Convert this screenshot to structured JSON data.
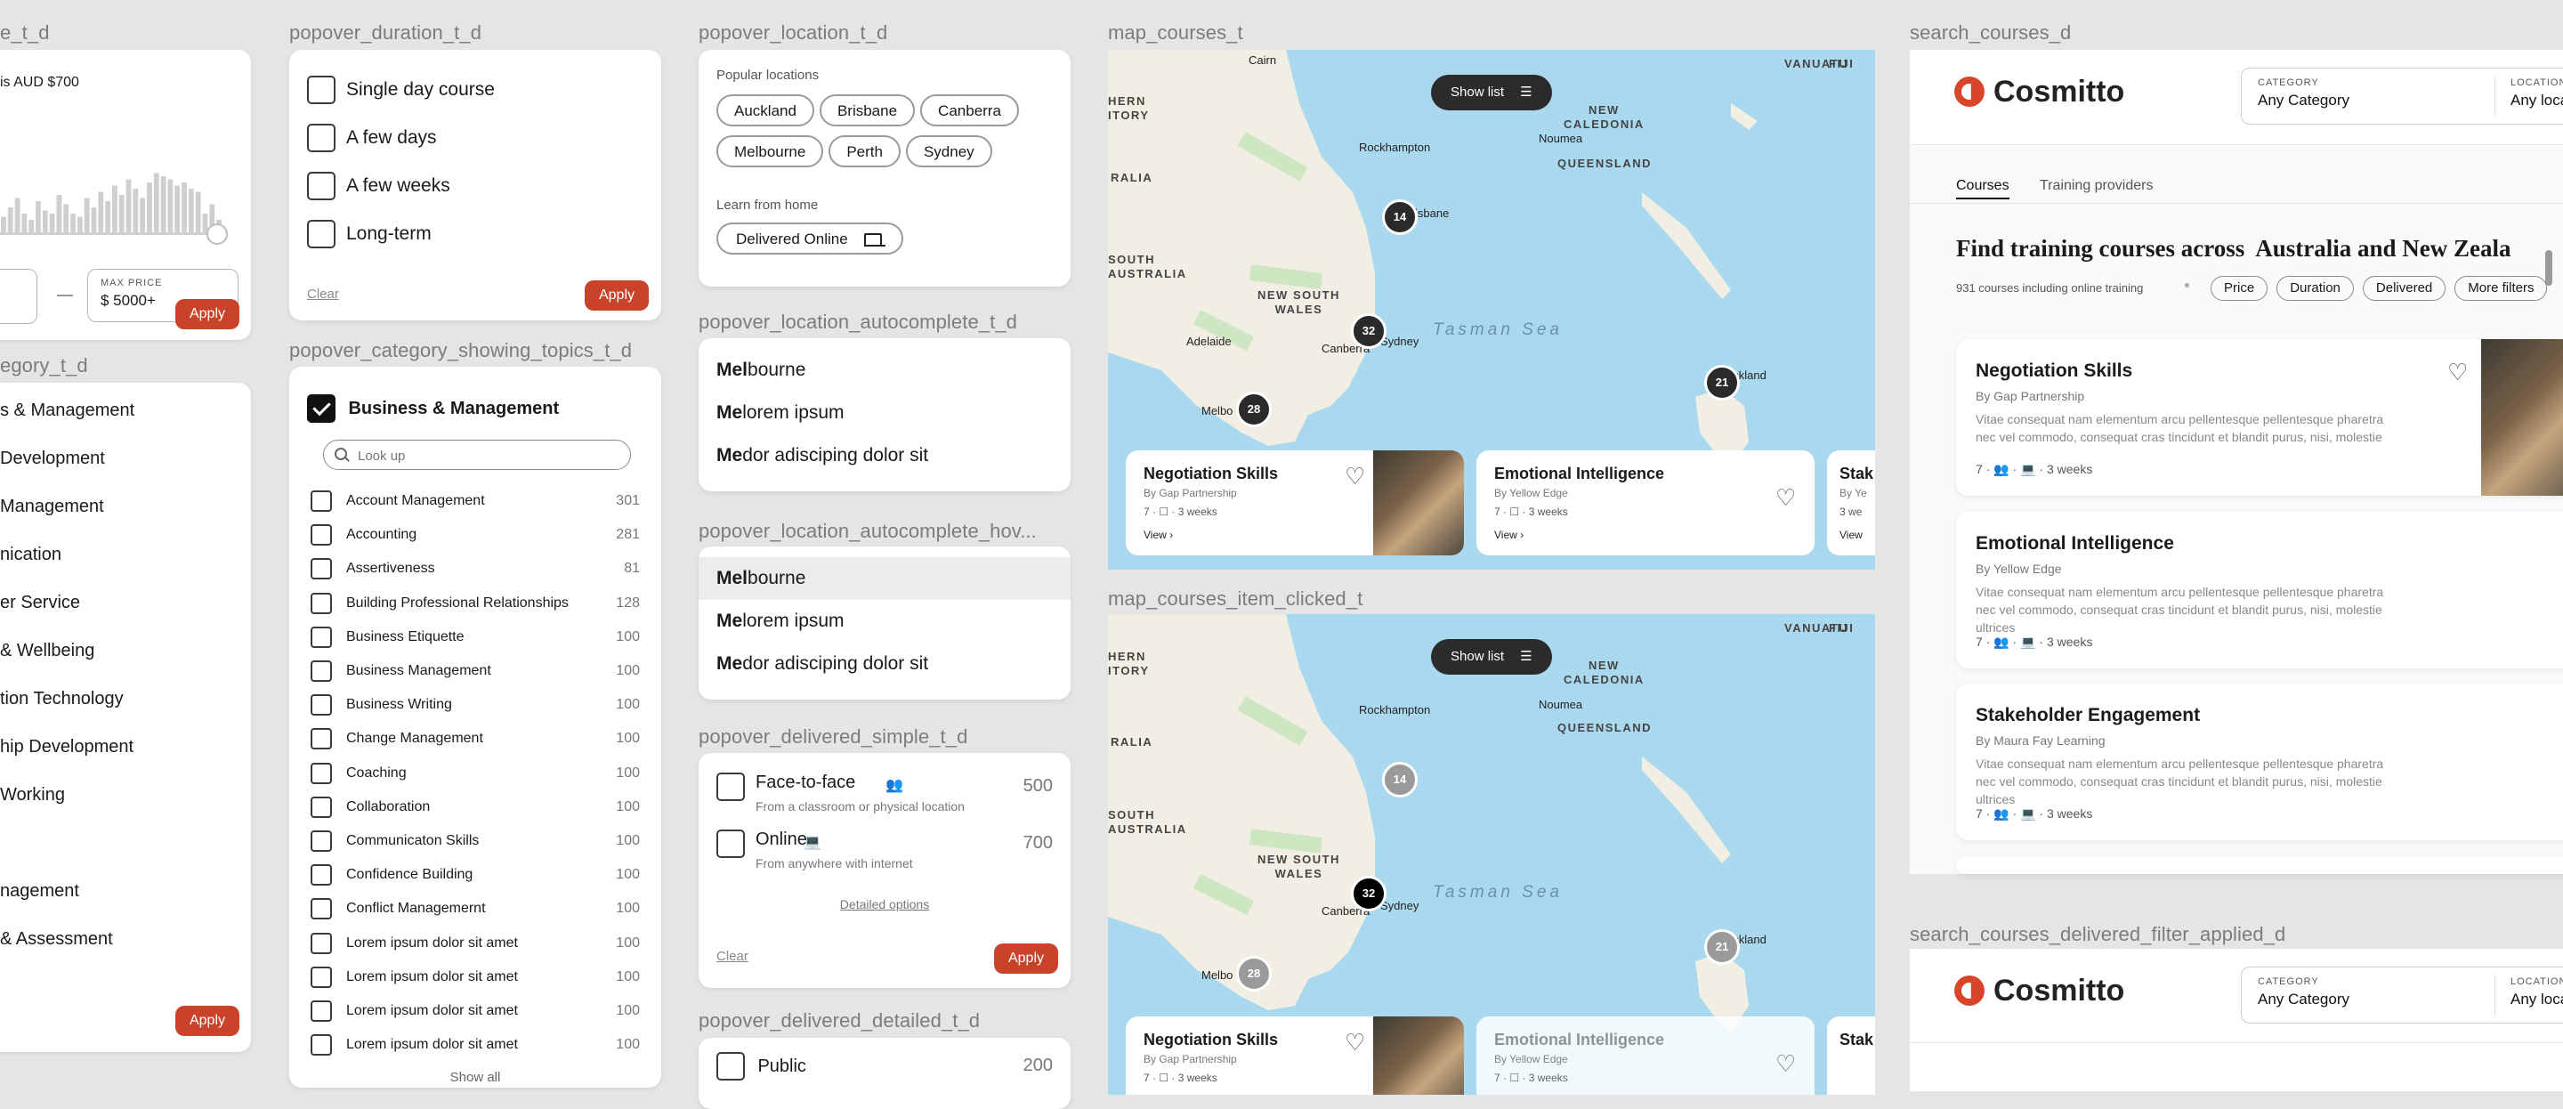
{
  "labels": {
    "price": "e_t_d",
    "category": "egory_t_d",
    "duration": "popover_duration_t_d",
    "category_topics": "popover_category_showing_topics_t_d",
    "location": "popover_location_t_d",
    "autocomplete": "popover_location_autocomplete_t_d",
    "autocomplete_hover": "popover_location_autocomplete_hov...",
    "delivered_simple": "popover_delivered_simple_t_d",
    "delivered_detailed": "popover_delivered_detailed_t_d",
    "map": "map_courses_t",
    "map_clicked": "map_courses_item_clicked_t",
    "search": "search_courses_d",
    "search_filtered": "search_courses_delivered_filter_applied_d"
  },
  "price_popover": {
    "avg_text": "is AUD $700",
    "histogram": [
      0.25,
      0.4,
      0.55,
      0.3,
      0.2,
      0.5,
      0.35,
      0.3,
      0.6,
      0.45,
      0.3,
      0.25,
      0.55,
      0.4,
      0.65,
      0.5,
      0.75,
      0.6,
      0.85,
      0.7,
      0.55,
      0.8,
      0.95,
      0.9,
      0.85,
      0.75,
      0.8,
      0.7,
      0.65,
      0.3,
      0.45,
      0.2
    ],
    "max_label": "MAX PRICE",
    "max_value": "$ 5000+",
    "apply": "Apply"
  },
  "category_popover": {
    "items": [
      "s & Management",
      "Development",
      "Management",
      "nication",
      "er Service",
      "& Wellbeing",
      "tion Technology",
      "hip Development",
      "Working",
      "",
      "nagement",
      "& Assessment"
    ],
    "apply": "Apply"
  },
  "duration_popover": {
    "options": [
      "Single day course",
      "A few days",
      "A few weeks",
      "Long-term"
    ],
    "clear": "Clear",
    "apply": "Apply"
  },
  "topics_popover": {
    "parent": "Business & Management",
    "search_placeholder": "Look up",
    "topics": [
      {
        "name": "Account Management",
        "count": "301"
      },
      {
        "name": "Accounting",
        "count": "281"
      },
      {
        "name": "Assertiveness",
        "count": "81"
      },
      {
        "name": "Building Professional Relationships",
        "count": "128"
      },
      {
        "name": "Business Etiquette",
        "count": "100"
      },
      {
        "name": "Business Management",
        "count": "100"
      },
      {
        "name": "Business Writing",
        "count": "100"
      },
      {
        "name": "Change Management",
        "count": "100"
      },
      {
        "name": "Coaching",
        "count": "100"
      },
      {
        "name": "Collaboration",
        "count": "100"
      },
      {
        "name": "Communicaton Skills",
        "count": "100"
      },
      {
        "name": "Confidence Building",
        "count": "100"
      },
      {
        "name": "Conflict Managemernt",
        "count": "100"
      },
      {
        "name": "Lorem ipsum dolor sit amet",
        "count": "100"
      },
      {
        "name": "Lorem ipsum dolor sit amet",
        "count": "100"
      },
      {
        "name": "Lorem ipsum dolor sit amet",
        "count": "100"
      },
      {
        "name": "Lorem ipsum dolor sit amet",
        "count": "100"
      }
    ],
    "show_all": "Show all"
  },
  "location_popover": {
    "popular_heading": "Popular locations",
    "cities": [
      "Auckland",
      "Brisbane",
      "Canberra",
      "Melbourne",
      "Perth",
      "Sydney"
    ],
    "home_heading": "Learn from home",
    "delivered_online": "Delivered Online"
  },
  "autocomplete": {
    "items": [
      {
        "match": "Mel",
        "rest": "bourne"
      },
      {
        "match": "Me",
        "rest": "lorem ipsum"
      },
      {
        "match": "Me",
        "rest": "dor adisciping dolor sit"
      }
    ]
  },
  "delivered_simple": {
    "options": [
      {
        "label": "Face-to-face",
        "sub": "From a classroom or physical location",
        "count": "500"
      },
      {
        "label": "Online",
        "sub": "From anywhere with internet",
        "count": "700"
      }
    ],
    "detailed_link": "Detailed options",
    "clear": "Clear",
    "apply": "Apply"
  },
  "delivered_detailed": {
    "first_option": "Public",
    "first_count": "200"
  },
  "map": {
    "show_list": "Show list",
    "labels": {
      "vanuatu": "VANUATU",
      "fiji": "FIJI",
      "new_caledonia": "NEW\nCALEDONIA",
      "queensland": "QUEENSLAND",
      "south_australia": "SOUTH\nAUSTRALIA",
      "nsw": "NEW SOUTH\nWALES",
      "tasman": "Tasman Sea",
      "territory": "HERN\nITORY",
      "ralia": "RALIA",
      "cairns": "Cairn",
      "rockhampton": "Rockhampton",
      "noumea": "Noumea",
      "brisbane": "isbane",
      "adelaide": "Adelaide",
      "canberra": "Canberra",
      "sydney": "Sydney",
      "melbourne": "Melbo",
      "auckland": "uckland"
    },
    "clusters": [
      "14",
      "32",
      "28",
      "21"
    ],
    "cards": [
      {
        "title": "Negotiation Skills",
        "by": "By Gap Partnership",
        "meta": "7  ·  ☐  ·  3 weeks",
        "view": "View ›"
      },
      {
        "title": "Emotional Intelligence",
        "by": "By Yellow Edge",
        "meta": "7  ·  ☐  ·  3 weeks",
        "view": "View ›"
      },
      {
        "title": "Stak",
        "by": "By Ye",
        "meta": "3 we",
        "view": "View"
      }
    ]
  },
  "search": {
    "brand": "Cosmitto",
    "category_label": "CATEGORY",
    "category_value": "Any Category",
    "location_label": "LOCATION",
    "location_value": "Any loca",
    "tabs": [
      "Courses",
      "Training providers"
    ],
    "headline": "Find training courses across  Australia and New Zeala",
    "count_text": "931 courses including online training",
    "filters": [
      "Price",
      "Duration",
      "Delivered",
      "More filters"
    ],
    "courses": [
      {
        "title": "Negotiation Skills",
        "by": "By Gap Partnership",
        "desc": "Vitae consequat nam elementum arcu pellentesque pellentesque pharetra nec vel commodo, consequat cras tincidunt et blandit purus, nisi, molestie",
        "meta": "7  ·  👥  ·  💻  ·  3 weeks"
      },
      {
        "title": "Emotional Intelligence",
        "by": "By Yellow Edge",
        "desc": "Vitae consequat nam elementum arcu pellentesque pellentesque pharetra nec vel commodo, consequat cras tincidunt et blandit purus, nisi, molestie ultrices",
        "meta": "7  ·  👥  ·  💻  ·  3 weeks"
      },
      {
        "title": "Stakeholder Engagement",
        "by": "By Maura Fay Learning",
        "desc": "Vitae consequat nam elementum arcu pellentesque pellentesque pharetra nec vel commodo, consequat cras tincidunt et blandit purus, nisi, molestie ultrices",
        "meta": "7  ·  👥  ·  💻  ·  3 weeks"
      }
    ]
  },
  "colors": {
    "accent": "#c9432a",
    "brand": "#d9452b",
    "map_water": "#aad9ef",
    "map_land": "#f1eee4"
  }
}
